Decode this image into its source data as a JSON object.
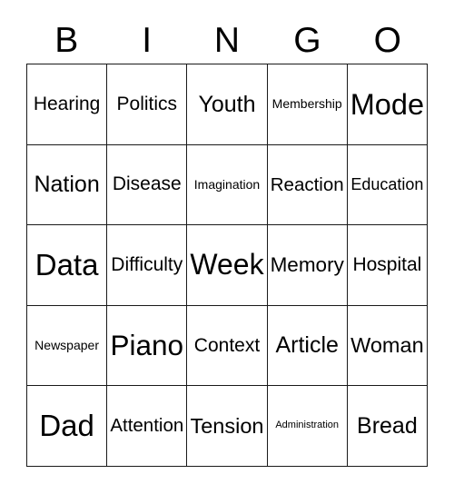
{
  "card": {
    "title": "BINGO",
    "background_color": "#ffffff",
    "text_color": "#000000",
    "border_color": "#1a1a1a"
  },
  "header": {
    "letters": [
      {
        "label": "B"
      },
      {
        "label": "I"
      },
      {
        "label": "N"
      },
      {
        "label": "G"
      },
      {
        "label": "O"
      }
    ]
  },
  "grid": {
    "rows": 5,
    "columns": 5,
    "cells": [
      [
        {
          "label": "Hearing",
          "size": "len-l"
        },
        {
          "label": "Politics",
          "size": "len-l"
        },
        {
          "label": "Youth",
          "size": "len-m"
        },
        {
          "label": "Membership",
          "size": "len-xl"
        },
        {
          "label": "Mode",
          "size": "len-s"
        }
      ],
      [
        {
          "label": "Nation",
          "size": "len-m"
        },
        {
          "label": "Disease",
          "size": "len-l"
        },
        {
          "label": "Imagination",
          "size": "len-xl"
        },
        {
          "label": "Reaction",
          "size": "len-l"
        },
        {
          "label": "Education",
          "size": "len-l"
        }
      ],
      [
        {
          "label": "Data",
          "size": "len-s"
        },
        {
          "label": "Difficulty",
          "size": "len-l"
        },
        {
          "label": "Week",
          "size": "len-s"
        },
        {
          "label": "Memory",
          "size": "len-m"
        },
        {
          "label": "Hospital",
          "size": "len-l"
        }
      ],
      [
        {
          "label": "Newspaper",
          "size": "len-xl"
        },
        {
          "label": "Piano",
          "size": "len-s"
        },
        {
          "label": "Context",
          "size": "len-l"
        },
        {
          "label": "Article",
          "size": "len-m"
        },
        {
          "label": "Woman",
          "size": "len-m"
        }
      ],
      [
        {
          "label": "Dad",
          "size": "len-s"
        },
        {
          "label": "Attention",
          "size": "len-l"
        },
        {
          "label": "Tension",
          "size": "len-m"
        },
        {
          "label": "Administration",
          "size": "len-xxl"
        },
        {
          "label": "Bread",
          "size": "len-m"
        }
      ]
    ]
  }
}
